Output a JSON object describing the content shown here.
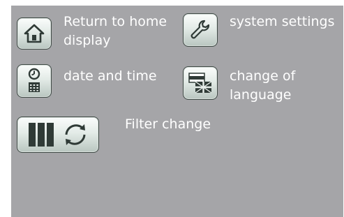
{
  "menu": {
    "home": {
      "label": "Return to home display",
      "icon": "home-icon"
    },
    "system_settings": {
      "label": "system settings",
      "icon": "wrench-icon"
    },
    "date_time": {
      "label": "date and time",
      "icon": "clock-calendar-icon"
    },
    "language": {
      "label": "change of language",
      "icon": "flag-icon"
    },
    "filter": {
      "label": "Filter change",
      "icon": "filter-change-icon"
    }
  },
  "colors": {
    "background": "#a5a5a8",
    "label_text": "#ffffff",
    "icon_dark": "#3f4a45"
  }
}
